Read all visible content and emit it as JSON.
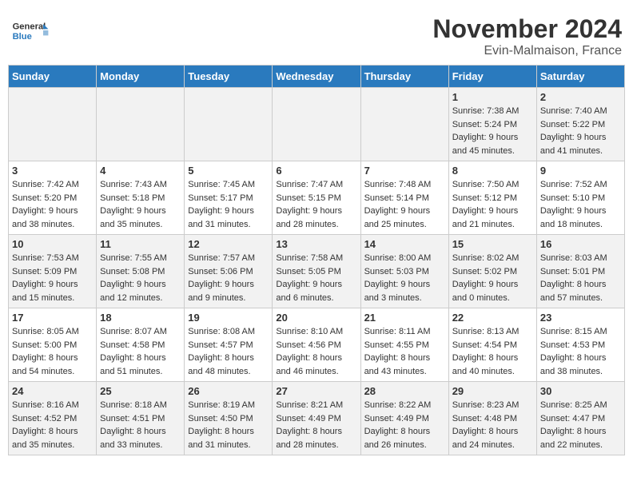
{
  "logo": {
    "line1": "General",
    "line2": "Blue"
  },
  "header": {
    "month": "November 2024",
    "location": "Evin-Malmaison, France"
  },
  "days_of_week": [
    "Sunday",
    "Monday",
    "Tuesday",
    "Wednesday",
    "Thursday",
    "Friday",
    "Saturday"
  ],
  "weeks": [
    [
      {
        "day": "",
        "info": ""
      },
      {
        "day": "",
        "info": ""
      },
      {
        "day": "",
        "info": ""
      },
      {
        "day": "",
        "info": ""
      },
      {
        "day": "",
        "info": ""
      },
      {
        "day": "1",
        "info": "Sunrise: 7:38 AM\nSunset: 5:24 PM\nDaylight: 9 hours\nand 45 minutes."
      },
      {
        "day": "2",
        "info": "Sunrise: 7:40 AM\nSunset: 5:22 PM\nDaylight: 9 hours\nand 41 minutes."
      }
    ],
    [
      {
        "day": "3",
        "info": "Sunrise: 7:42 AM\nSunset: 5:20 PM\nDaylight: 9 hours\nand 38 minutes."
      },
      {
        "day": "4",
        "info": "Sunrise: 7:43 AM\nSunset: 5:18 PM\nDaylight: 9 hours\nand 35 minutes."
      },
      {
        "day": "5",
        "info": "Sunrise: 7:45 AM\nSunset: 5:17 PM\nDaylight: 9 hours\nand 31 minutes."
      },
      {
        "day": "6",
        "info": "Sunrise: 7:47 AM\nSunset: 5:15 PM\nDaylight: 9 hours\nand 28 minutes."
      },
      {
        "day": "7",
        "info": "Sunrise: 7:48 AM\nSunset: 5:14 PM\nDaylight: 9 hours\nand 25 minutes."
      },
      {
        "day": "8",
        "info": "Sunrise: 7:50 AM\nSunset: 5:12 PM\nDaylight: 9 hours\nand 21 minutes."
      },
      {
        "day": "9",
        "info": "Sunrise: 7:52 AM\nSunset: 5:10 PM\nDaylight: 9 hours\nand 18 minutes."
      }
    ],
    [
      {
        "day": "10",
        "info": "Sunrise: 7:53 AM\nSunset: 5:09 PM\nDaylight: 9 hours\nand 15 minutes."
      },
      {
        "day": "11",
        "info": "Sunrise: 7:55 AM\nSunset: 5:08 PM\nDaylight: 9 hours\nand 12 minutes."
      },
      {
        "day": "12",
        "info": "Sunrise: 7:57 AM\nSunset: 5:06 PM\nDaylight: 9 hours\nand 9 minutes."
      },
      {
        "day": "13",
        "info": "Sunrise: 7:58 AM\nSunset: 5:05 PM\nDaylight: 9 hours\nand 6 minutes."
      },
      {
        "day": "14",
        "info": "Sunrise: 8:00 AM\nSunset: 5:03 PM\nDaylight: 9 hours\nand 3 minutes."
      },
      {
        "day": "15",
        "info": "Sunrise: 8:02 AM\nSunset: 5:02 PM\nDaylight: 9 hours\nand 0 minutes."
      },
      {
        "day": "16",
        "info": "Sunrise: 8:03 AM\nSunset: 5:01 PM\nDaylight: 8 hours\nand 57 minutes."
      }
    ],
    [
      {
        "day": "17",
        "info": "Sunrise: 8:05 AM\nSunset: 5:00 PM\nDaylight: 8 hours\nand 54 minutes."
      },
      {
        "day": "18",
        "info": "Sunrise: 8:07 AM\nSunset: 4:58 PM\nDaylight: 8 hours\nand 51 minutes."
      },
      {
        "day": "19",
        "info": "Sunrise: 8:08 AM\nSunset: 4:57 PM\nDaylight: 8 hours\nand 48 minutes."
      },
      {
        "day": "20",
        "info": "Sunrise: 8:10 AM\nSunset: 4:56 PM\nDaylight: 8 hours\nand 46 minutes."
      },
      {
        "day": "21",
        "info": "Sunrise: 8:11 AM\nSunset: 4:55 PM\nDaylight: 8 hours\nand 43 minutes."
      },
      {
        "day": "22",
        "info": "Sunrise: 8:13 AM\nSunset: 4:54 PM\nDaylight: 8 hours\nand 40 minutes."
      },
      {
        "day": "23",
        "info": "Sunrise: 8:15 AM\nSunset: 4:53 PM\nDaylight: 8 hours\nand 38 minutes."
      }
    ],
    [
      {
        "day": "24",
        "info": "Sunrise: 8:16 AM\nSunset: 4:52 PM\nDaylight: 8 hours\nand 35 minutes."
      },
      {
        "day": "25",
        "info": "Sunrise: 8:18 AM\nSunset: 4:51 PM\nDaylight: 8 hours\nand 33 minutes."
      },
      {
        "day": "26",
        "info": "Sunrise: 8:19 AM\nSunset: 4:50 PM\nDaylight: 8 hours\nand 31 minutes."
      },
      {
        "day": "27",
        "info": "Sunrise: 8:21 AM\nSunset: 4:49 PM\nDaylight: 8 hours\nand 28 minutes."
      },
      {
        "day": "28",
        "info": "Sunrise: 8:22 AM\nSunset: 4:49 PM\nDaylight: 8 hours\nand 26 minutes."
      },
      {
        "day": "29",
        "info": "Sunrise: 8:23 AM\nSunset: 4:48 PM\nDaylight: 8 hours\nand 24 minutes."
      },
      {
        "day": "30",
        "info": "Sunrise: 8:25 AM\nSunset: 4:47 PM\nDaylight: 8 hours\nand 22 minutes."
      }
    ]
  ]
}
